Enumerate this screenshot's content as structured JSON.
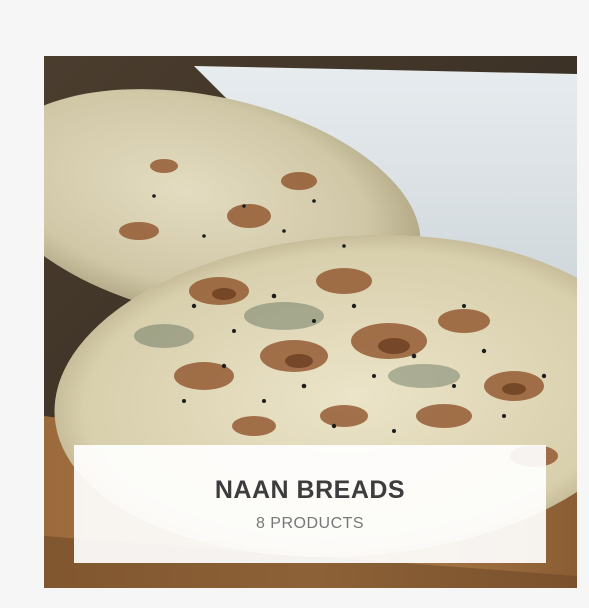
{
  "category": {
    "title": "NAAN BREADS",
    "count_label": "8 PRODUCTS",
    "image_subject": "naan-bread-photo"
  },
  "colors": {
    "page_background": "#f6f6f6",
    "caption_background": "#ffffff",
    "title_color": "#3d3d3d",
    "count_color": "#777777"
  }
}
